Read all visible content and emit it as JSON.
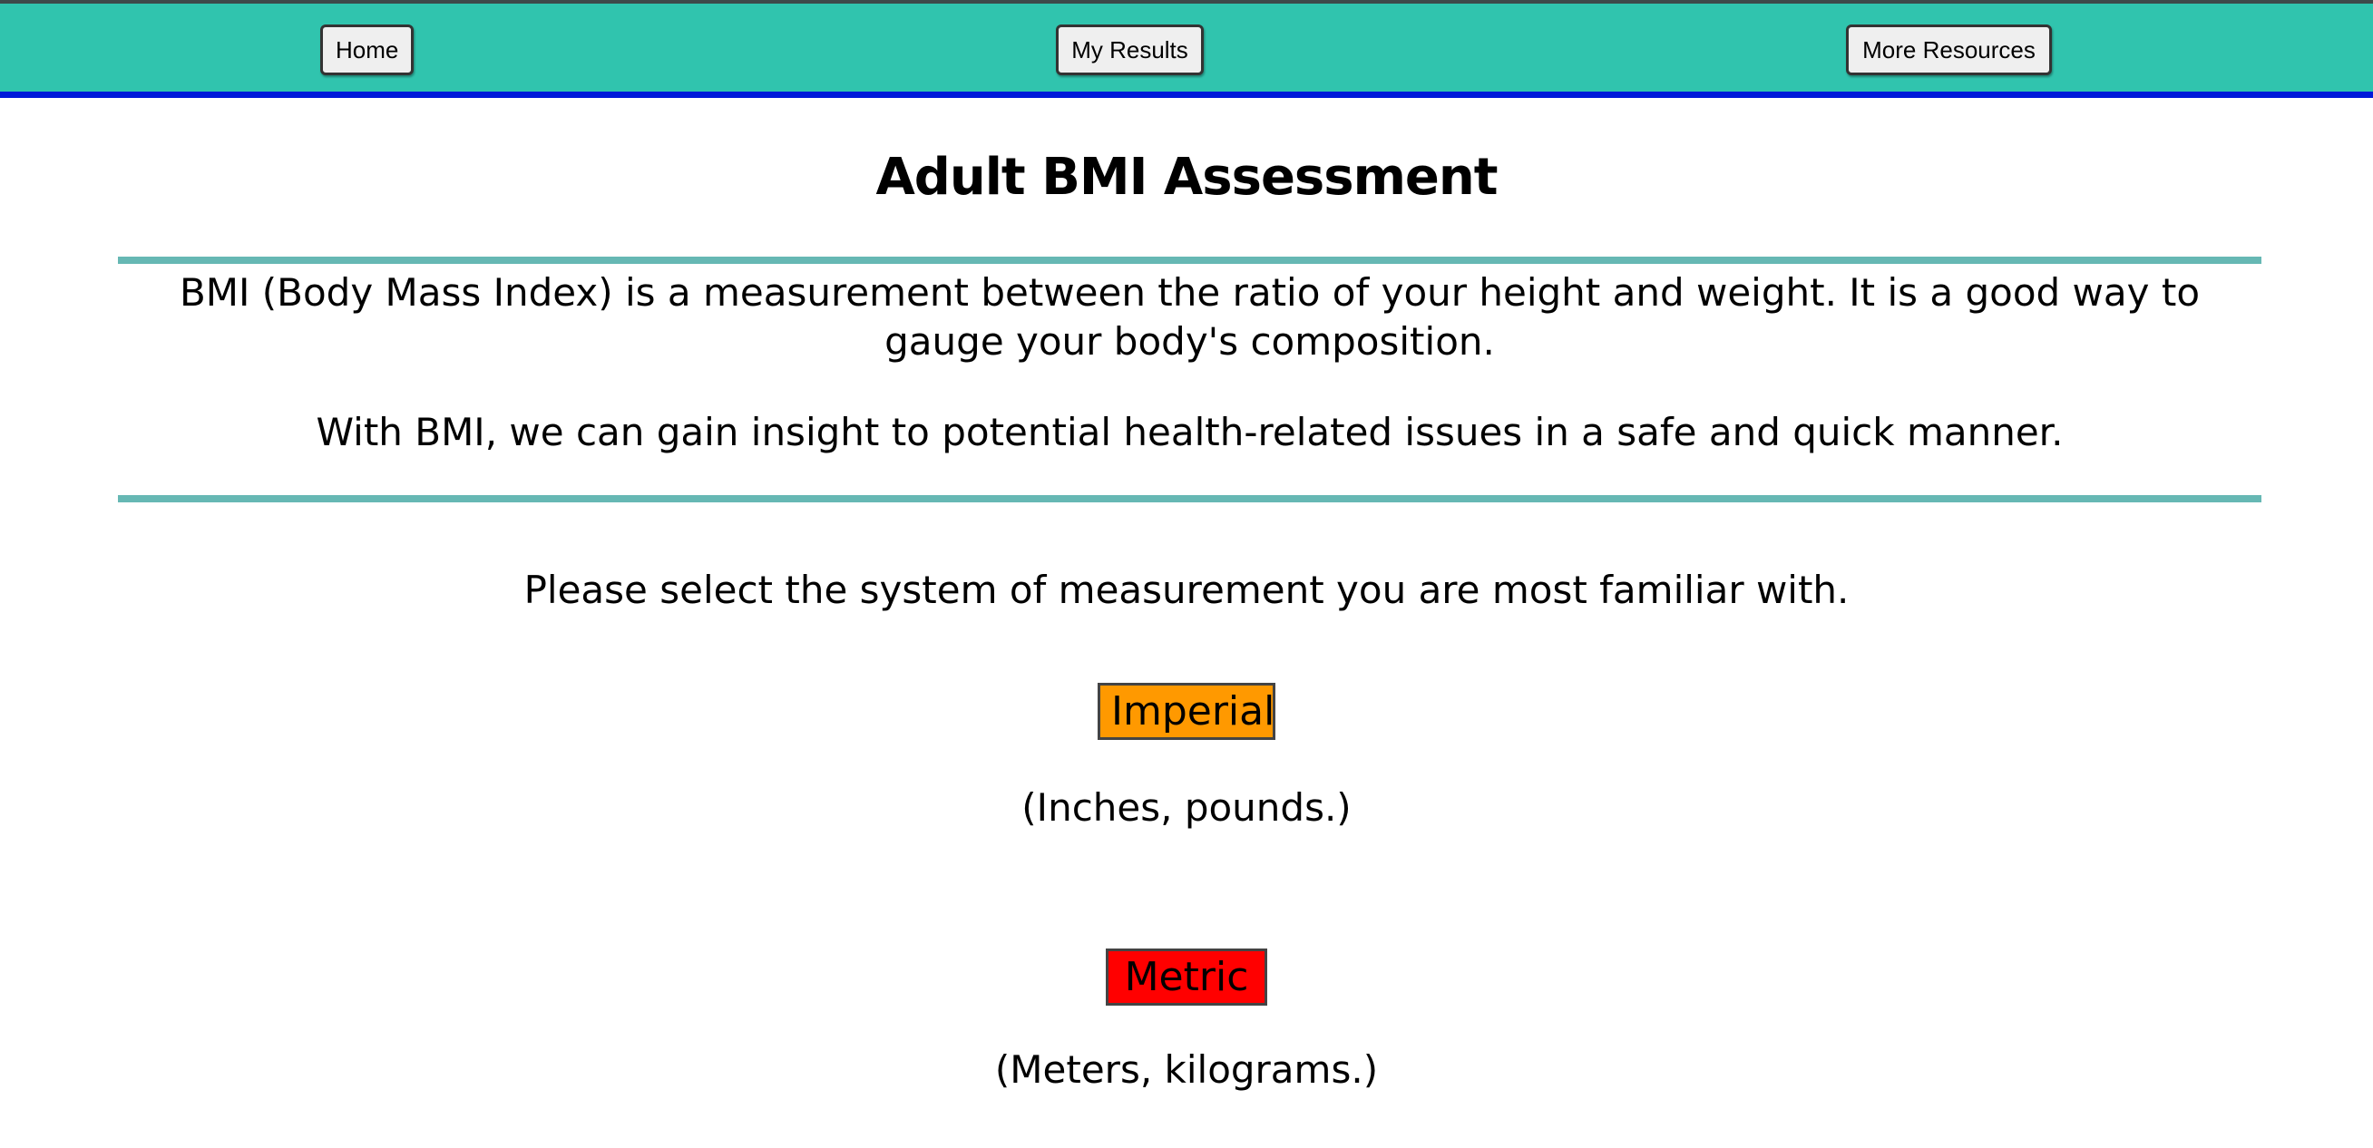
{
  "nav": {
    "home_label": "Home",
    "results_label": "My Results",
    "resources_label": "More Resources"
  },
  "header": {
    "title": "Adult BMI Assessment"
  },
  "intro": {
    "paragraph_1": "BMI (Body Mass Index) is a measurement between the ratio of your height and weight. It is a good way to gauge your body's composition.",
    "paragraph_2": "With BMI, we can gain insight to potential health-related issues in a safe and quick manner."
  },
  "selection": {
    "prompt": "Please select the system of measurement you are most familiar with.",
    "imperial_label": "Imperial",
    "imperial_note": "(Inches, pounds.)",
    "metric_label": "Metric",
    "metric_note": "(Meters, kilograms.)"
  },
  "colors": {
    "navbar": "#30c4ae",
    "navbar_border": "#0019d9",
    "divider": "#66b8b4",
    "imperial": "#ff9900",
    "metric": "#ff0000"
  }
}
